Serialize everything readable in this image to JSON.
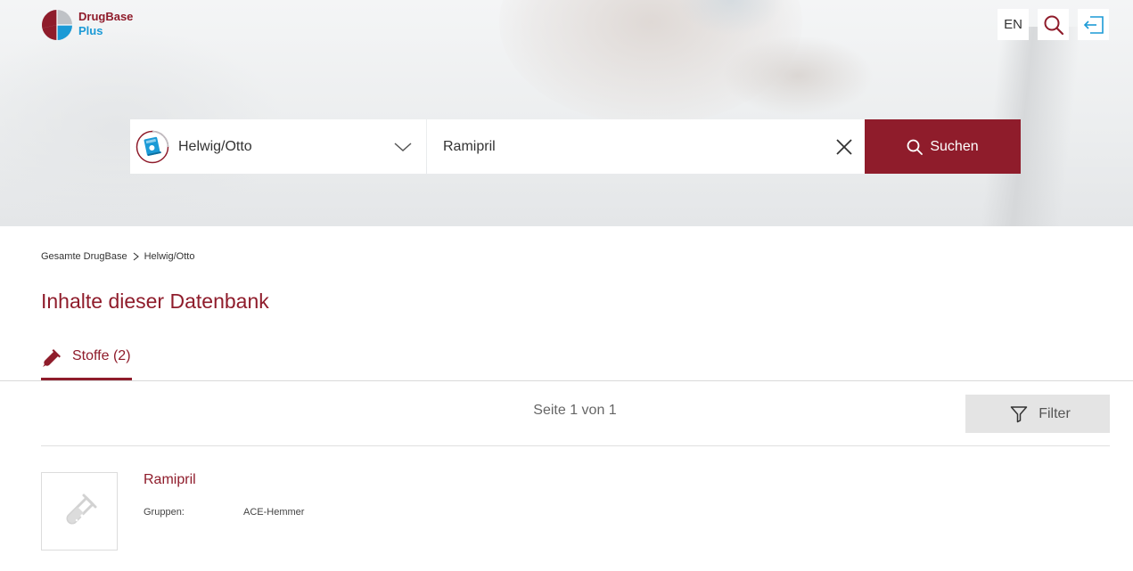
{
  "brand": {
    "name_line1": "DrugBase",
    "name_line2": "Plus",
    "colors": {
      "primary": "#8f1c2b",
      "secondary": "#1b9ad6",
      "logo_grey": "#bfc2c6"
    }
  },
  "header": {
    "language_button": "EN",
    "search_icon": "search-icon",
    "logout_icon": "logout-icon"
  },
  "search": {
    "database_select": {
      "selected": "Helwig/Otto",
      "icon": "book-icon"
    },
    "query": "Ramipril",
    "clear_icon": "close-icon",
    "submit_label": "Suchen"
  },
  "breadcrumb": {
    "items": [
      "Gesamte DrugBase",
      "Helwig/Otto"
    ]
  },
  "page_title": "Inhalte dieser Datenbank",
  "tabs": [
    {
      "label": "Stoffe (2)",
      "icon": "test-tube-icon",
      "active": true
    }
  ],
  "pagination": {
    "text": "Seite 1 von 1"
  },
  "filter": {
    "label": "Filter",
    "icon": "funnel-icon"
  },
  "results": [
    {
      "title": "Ramipril",
      "thumbnail_icon": "test-tube-icon",
      "fields": [
        {
          "key": "Gruppen:",
          "value": "ACE-Hemmer"
        }
      ]
    }
  ]
}
